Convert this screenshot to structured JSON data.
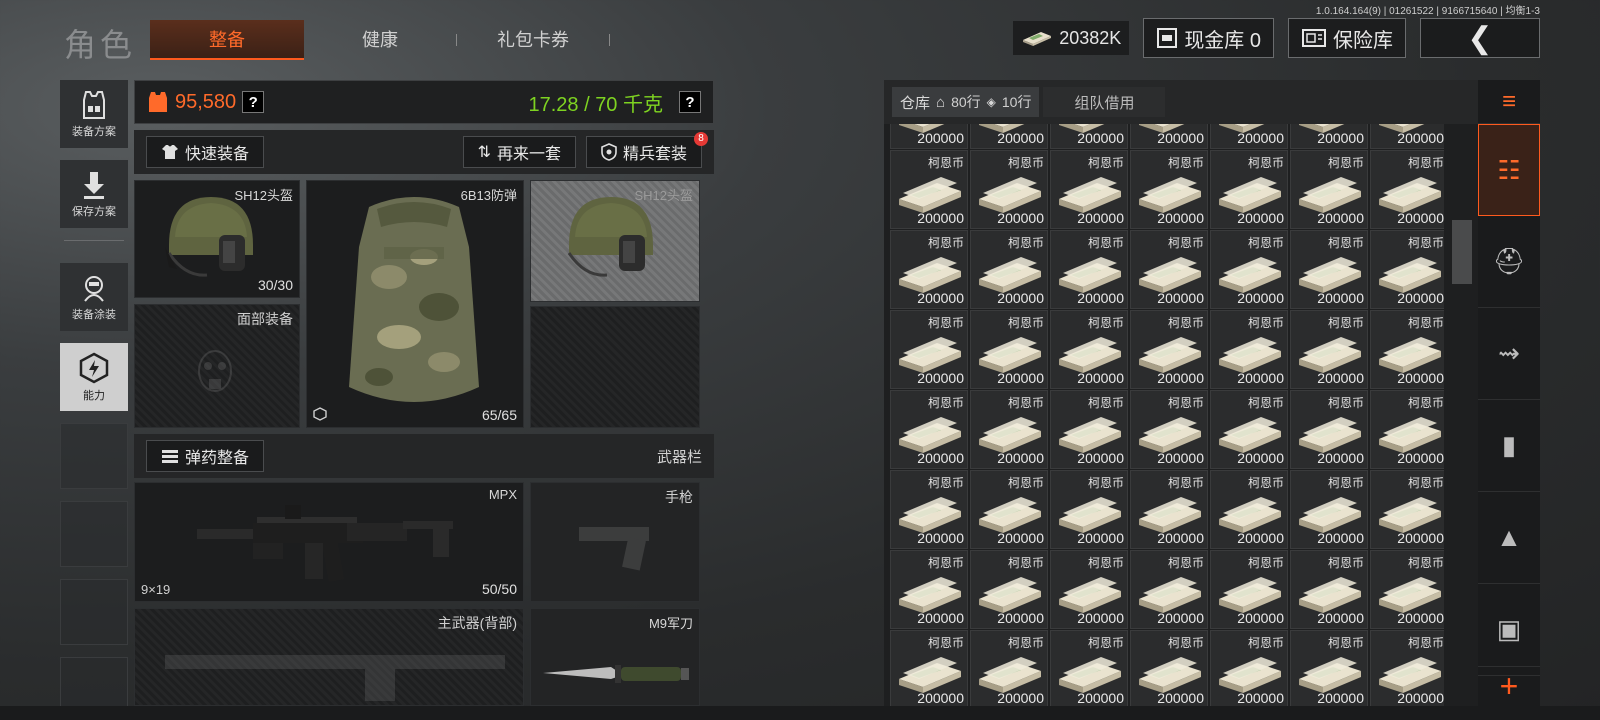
{
  "version": "1.0.164.164(9) | 01261522 | 9166715640 | 均衡1-3",
  "header": {
    "title": "角色",
    "tabs": [
      {
        "label": "整备",
        "active": true
      },
      {
        "label": "健康"
      },
      {
        "label": "礼包卡券"
      }
    ],
    "money": "20382K",
    "cash_vault": "现金库 0",
    "safe_box": "保险库",
    "back_icon": "chevron-left-icon"
  },
  "side_nav": [
    {
      "label": "装备方案",
      "icon": "vest-icon"
    },
    {
      "label": "保存方案",
      "icon": "download-icon"
    },
    {
      "label": "装备涂装",
      "icon": "skin-icon"
    },
    {
      "label": "能力",
      "icon": "ability-icon",
      "active": true
    }
  ],
  "loadout": {
    "value": "95,580",
    "weight": "17.28 / 70 千克",
    "help": "?",
    "quick_equip": "快速装备",
    "another_set": "再来一套",
    "elite_set": "精兵套装",
    "elite_badge": "8",
    "slots": {
      "helmet": {
        "name": "SH12头盔",
        "durability": "30/30"
      },
      "armor": {
        "name": "6B13防弹",
        "durability": "65/65"
      },
      "helmet_preview": {
        "name": "SH12头盔"
      },
      "face": {
        "name": "面部装备"
      }
    },
    "ammo_prep": "弹药整备",
    "weapon_bar": "武器栏",
    "primary": {
      "name": "MPX",
      "caliber": "9×19",
      "ammo": "50/50"
    },
    "pistol": {
      "name": "手枪"
    },
    "back_weapon": {
      "name": "主武器(背部)"
    },
    "melee": {
      "name": "M9军刀"
    }
  },
  "storage": {
    "tab_label": "仓库",
    "rows_label": "80行",
    "rows10_label": "10行",
    "team_label": "组队借用",
    "item_name": "柯恩币",
    "item_amount": "200000"
  },
  "colors": {
    "accent": "#ff6a2a",
    "weight": "#7ed321"
  }
}
